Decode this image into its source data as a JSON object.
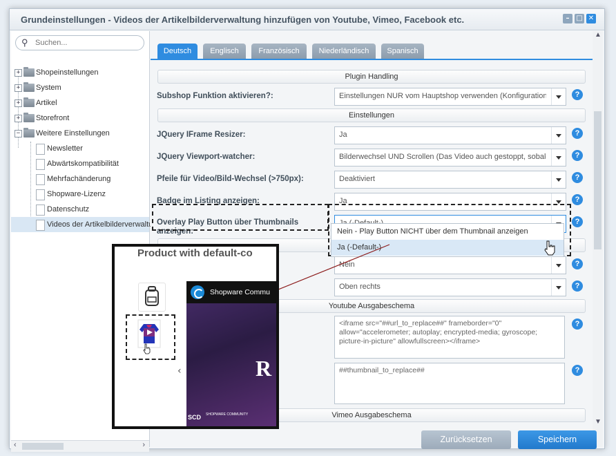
{
  "window": {
    "title": "Grundeinstellungen - Videos der Artikelbilderverwaltung hinzufügen von Youtube, Vimeo, Facebook etc.",
    "buttons": {
      "minimize": "–",
      "maximize": "□",
      "close": "✕"
    }
  },
  "sidebar": {
    "search_placeholder": "Suchen...",
    "tree": [
      {
        "label": "Shopeinstellungen",
        "type": "folder",
        "expanded": false
      },
      {
        "label": "System",
        "type": "folder",
        "expanded": false
      },
      {
        "label": "Artikel",
        "type": "folder",
        "expanded": false
      },
      {
        "label": "Storefront",
        "type": "folder",
        "expanded": false
      },
      {
        "label": "Weitere Einstellungen",
        "type": "folder",
        "expanded": true
      },
      {
        "label": "Newsletter",
        "type": "doc"
      },
      {
        "label": "Abwärtskompatibilität",
        "type": "doc"
      },
      {
        "label": "Mehrfachänderung",
        "type": "doc"
      },
      {
        "label": "Shopware-Lizenz",
        "type": "doc"
      },
      {
        "label": "Datenschutz",
        "type": "doc"
      },
      {
        "label": "Videos der Artikelbilderverwaltung",
        "type": "doc",
        "selected": true
      }
    ]
  },
  "tabs": [
    {
      "label": "Deutsch",
      "active": true
    },
    {
      "label": "Englisch"
    },
    {
      "label": "Französisch"
    },
    {
      "label": "Niederländisch"
    },
    {
      "label": "Spanisch"
    }
  ],
  "form": {
    "sections": {
      "plugin_handling": "Plugin Handling",
      "einstellungen": "Einstellungen",
      "youtube": "Youtube Ausgabeschema",
      "vimeo": "Vimeo Ausgabeschema"
    },
    "fields": {
      "subshop": {
        "label": "Subshop Funktion aktivieren?:",
        "value": "Einstellungen NUR vom Hauptshop verwenden (Konfigurationen in Subshops werden ignoriert)"
      },
      "iframe_resizer": {
        "label": "JQuery IFrame Resizer:",
        "value": "Ja"
      },
      "viewport_watcher": {
        "label": "JQuery Viewport-watcher:",
        "value": "Bilderwechsel UND Scrollen (Das Video auch gestoppt, sobald es aus dem Viewport gescrollt wird)"
      },
      "pfeile": {
        "label": "Pfeile für Video/Bild-Wechsel (>750px):",
        "value": "Deaktiviert"
      },
      "badge": {
        "label": "Badge im Listing anzeigen:",
        "value": "Ja"
      },
      "overlay_play": {
        "label": "Overlay Play Button über Thumbnails anzeigen:",
        "value": "Ja (-Default-)"
      },
      "hidden_below": {
        "value": "Nein"
      },
      "position": {
        "value": "Oben rechts"
      },
      "youtube_code": "<iframe src=\"##url_to_replace##\" frameborder=\"0\" allow=\"accelerometer; autoplay; encrypted-media; gyroscope; picture-in-picture\" allowfullscreen></iframe>",
      "youtube_thumb": "##thumbnail_to_replace##"
    },
    "help_glyph": "?"
  },
  "dropdown": {
    "options": [
      "Nein - Play Button NICHT über dem Thumbnail anzeigen",
      "Ja (-Default-)"
    ],
    "highlighted": 1
  },
  "overlay_preview": {
    "title": "Product with default-co",
    "video_channel": "Shopware Commu",
    "big_letter": "R",
    "brand": "SCD",
    "brand_sub": "SHOPWARE COMMUNITY"
  },
  "footer": {
    "reset": "Zurücksetzen",
    "save": "Speichern"
  },
  "colors": {
    "accent": "#2f8ce0",
    "connector": "#8b1a1a"
  }
}
